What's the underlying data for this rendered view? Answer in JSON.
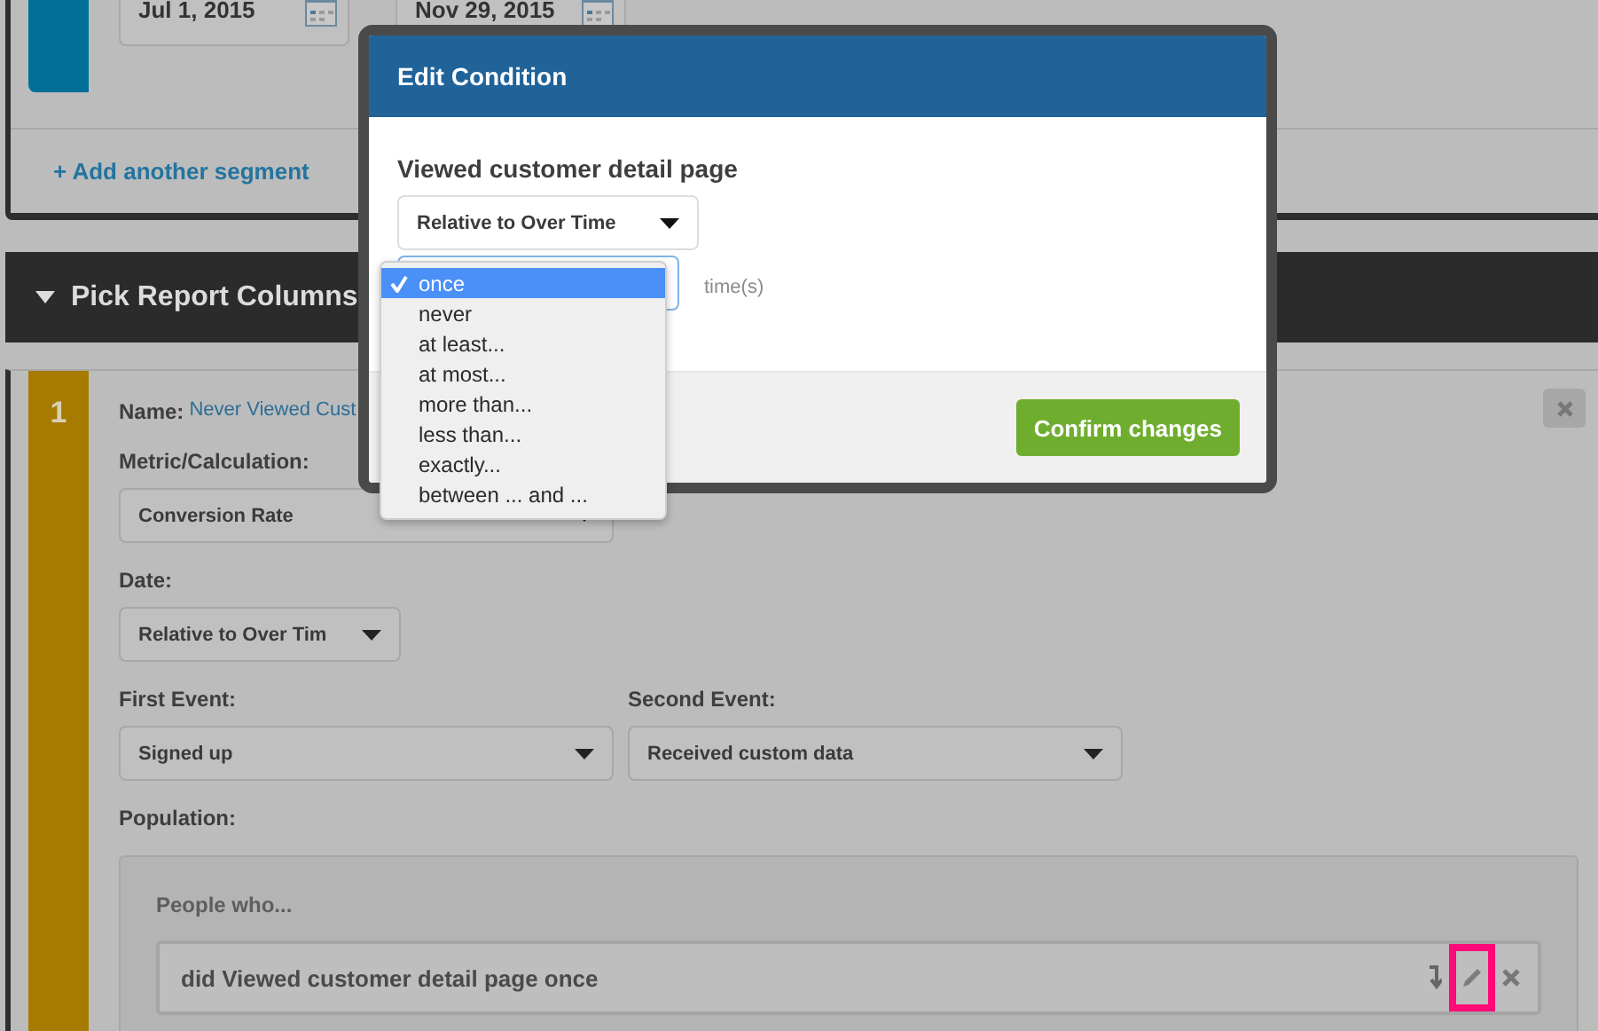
{
  "segment": {
    "start_date": "Jul 1, 2015",
    "end_date": "Nov 29, 2015",
    "add_link": "+ Add another segment"
  },
  "section": {
    "title": "Pick Report Columns",
    "expanded": true
  },
  "column": {
    "number": "1",
    "name_label": "Name:",
    "name_value": "Never Viewed Cust",
    "metric": {
      "label": "Metric/Calculation:",
      "value": "Conversion Rate"
    },
    "date": {
      "label": "Date:",
      "value": "Relative to Over Tim"
    },
    "first_event": {
      "label": "First Event:",
      "value": "Signed up"
    },
    "second_event": {
      "label": "Second Event:",
      "value": "Received custom data"
    },
    "population": {
      "label": "Population:",
      "intro": "People who...",
      "conditions": [
        {
          "text": "did Viewed customer detail page once",
          "actions": [
            {
              "kind": "move",
              "highlighted": false
            },
            {
              "kind": "edit",
              "highlighted": true
            },
            {
              "kind": "remove",
              "highlighted": false
            }
          ]
        }
      ]
    }
  },
  "modal": {
    "title": "Edit Condition",
    "event": "Viewed customer detail page",
    "date_select": "Relative to Over Time",
    "unit": "time(s)",
    "confirm": "Confirm changes",
    "frequency_options": [
      {
        "label": "once",
        "selected": true
      },
      {
        "label": "never",
        "selected": false
      },
      {
        "label": "at least...",
        "selected": false
      },
      {
        "label": "at most...",
        "selected": false
      },
      {
        "label": "more than...",
        "selected": false
      },
      {
        "label": "less than...",
        "selected": false
      },
      {
        "label": "exactly...",
        "selected": false
      },
      {
        "label": "between ... and ...",
        "selected": false
      }
    ]
  }
}
